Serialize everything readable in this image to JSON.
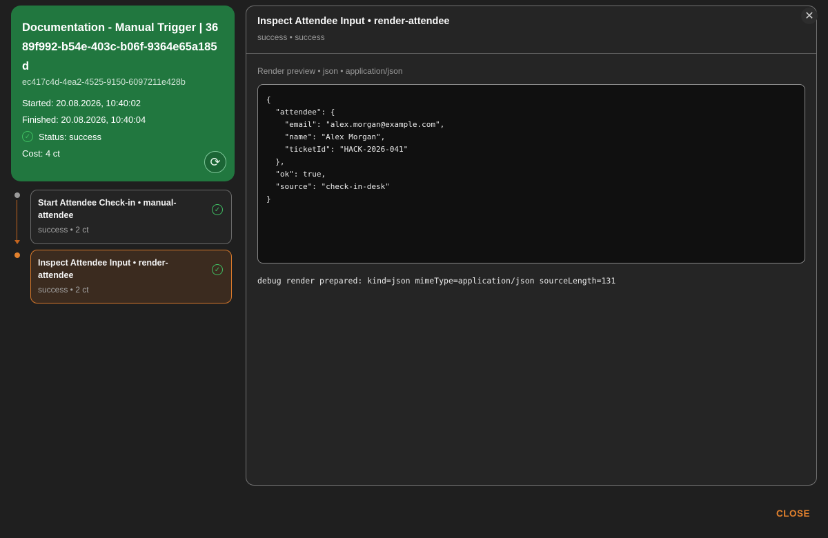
{
  "run": {
    "title": "Documentation - Manual Trigger | 3689f992-b54e-403c-b06f-9364e65a185d",
    "id": "ec417c4d-4ea2-4525-9150-6097211e428b",
    "started": "Started: 20.08.2026, 10:40:02",
    "finished": "Finished: 20.08.2026, 10:40:04",
    "status": "Status: success",
    "cost": "Cost: 4 ct",
    "accent": "#21773f"
  },
  "icons": {
    "status": "check-circle-icon",
    "rerun": "refresh-icon",
    "close": "close-icon"
  },
  "steps": [
    {
      "title": "Start Attendee Check-in • manual-attendee",
      "subtitle": "success • 2 ct",
      "selected": false
    },
    {
      "title": "Inspect Attendee Input • render-attendee",
      "subtitle": "success • 2 ct",
      "selected": true
    }
  ],
  "panel": {
    "title": "Inspect Attendee Input • render-attendee",
    "subtitle": "success • success",
    "preview_label": "Render preview • json • application/json",
    "code": "{\n  \"attendee\": {\n    \"email\": \"alex.morgan@example.com\",\n    \"name\": \"Alex Morgan\",\n    \"ticketId\": \"HACK-2026-041\"\n  },\n  \"ok\": true,\n  \"source\": \"check-in-desk\"\n}",
    "debug": "debug render prepared: kind=json mimeType=application/json sourceLength=131"
  },
  "footer": {
    "close_label": "CLOSE",
    "accent": "#e2812d"
  }
}
